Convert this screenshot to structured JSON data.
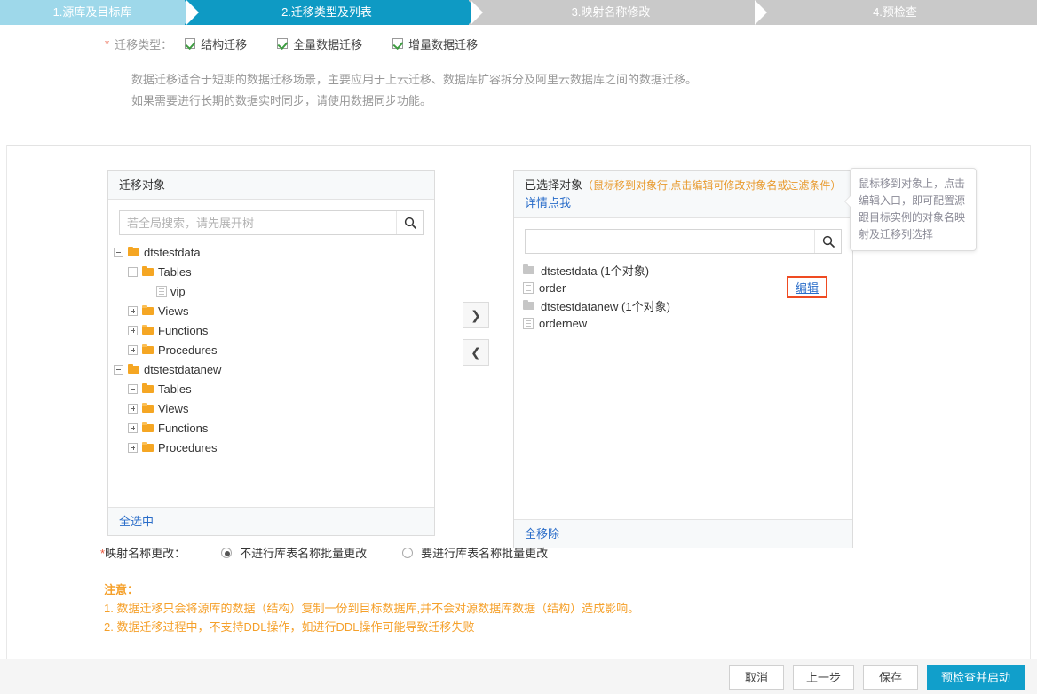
{
  "steps": [
    {
      "label": "1.源库及目标库",
      "state": "done"
    },
    {
      "label": "2.迁移类型及列表",
      "state": "active"
    },
    {
      "label": "3.映射名称修改",
      "state": "todo"
    },
    {
      "label": "4.预检查",
      "state": "todo"
    }
  ],
  "migration_type": {
    "required_mark": "*",
    "label": "迁移类型：",
    "options": [
      {
        "label": "结构迁移",
        "checked": true
      },
      {
        "label": "全量数据迁移",
        "checked": true
      },
      {
        "label": "增量数据迁移",
        "checked": true
      }
    ]
  },
  "description": {
    "line1": "数据迁移适合于短期的数据迁移场景，主要应用于上云迁移、数据库扩容拆分及阿里云数据库之间的数据迁移。",
    "line2": "如果需要进行长期的数据实时同步，请使用数据同步功能。"
  },
  "left_panel": {
    "title": "迁移对象",
    "search_placeholder": "若全局搜索，请先展开树",
    "search_value": "",
    "search_icon": "search-icon",
    "footer_link": "全选中",
    "tree": [
      {
        "label": "dtstestdata",
        "indent": 0,
        "toggle": "minus",
        "icon": "folder-open"
      },
      {
        "label": "Tables",
        "indent": 1,
        "toggle": "minus",
        "icon": "folder-open"
      },
      {
        "label": "vip",
        "indent": 2,
        "toggle": "none",
        "icon": "file"
      },
      {
        "label": "Views",
        "indent": 1,
        "toggle": "plus",
        "icon": "folder"
      },
      {
        "label": "Functions",
        "indent": 1,
        "toggle": "plus",
        "icon": "folder"
      },
      {
        "label": "Procedures",
        "indent": 1,
        "toggle": "plus",
        "icon": "folder"
      },
      {
        "label": "dtstestdatanew",
        "indent": 0,
        "toggle": "minus",
        "icon": "folder-open"
      },
      {
        "label": "Tables",
        "indent": 1,
        "toggle": "minus",
        "icon": "folder-open"
      },
      {
        "label": "Views",
        "indent": 1,
        "toggle": "plus",
        "icon": "folder"
      },
      {
        "label": "Functions",
        "indent": 1,
        "toggle": "plus",
        "icon": "folder"
      },
      {
        "label": "Procedures",
        "indent": 1,
        "toggle": "plus",
        "icon": "folder"
      }
    ]
  },
  "transfer": {
    "move_right_icon": "chevron-right-icon",
    "move_left_icon": "chevron-left-icon",
    "move_right_label": "❯",
    "move_left_label": "❮"
  },
  "right_panel": {
    "title": "已选择对象",
    "title_note": "（鼠标移到对象行,点击编辑可修改对象名或过滤条件）",
    "title_link": "详情点我",
    "search_placeholder": "",
    "search_value": "",
    "search_icon": "search-icon",
    "footer_link": "全移除",
    "items": [
      {
        "label": "dtstestdata (1个对象)",
        "icon": "folder-grey",
        "edit": null
      },
      {
        "label": "order",
        "icon": "file",
        "edit": "编辑"
      },
      {
        "label": "dtstestdatanew (1个对象)",
        "icon": "folder-grey",
        "edit": null
      },
      {
        "label": "ordernew",
        "icon": "file",
        "edit": null
      }
    ]
  },
  "tooltip": {
    "text": "鼠标移到对象上，点击编辑入口，即可配置源跟目标实例的对象名映射及迁移列选择"
  },
  "mapping": {
    "required_mark": "*",
    "label": "映射名称更改：",
    "options": [
      {
        "label": "不进行库表名称批量更改",
        "selected": true
      },
      {
        "label": "要进行库表名称批量更改",
        "selected": false
      }
    ]
  },
  "notes": {
    "title": "注意：",
    "lines": [
      "1. 数据迁移只会将源库的数据（结构）复制一份到目标数据库,并不会对源数据库数据（结构）造成影响。",
      "2. 数据迁移过程中，不支持DDL操作，如进行DDL操作可能导致迁移失败"
    ]
  },
  "footer": {
    "cancel": "取消",
    "previous": "上一步",
    "save": "保存",
    "precheck": "预检查并启动"
  },
  "colors": {
    "step_active": "#0e9ac4",
    "step_done": "#9ed8ea",
    "step_todo": "#c9c9c9",
    "primary_button": "#119fcb",
    "link": "#2a6dc9",
    "warning": "#f5a02a",
    "highlight_border": "#ef4b22",
    "required_star": "#e8553a",
    "check_green": "#3d9c40"
  }
}
